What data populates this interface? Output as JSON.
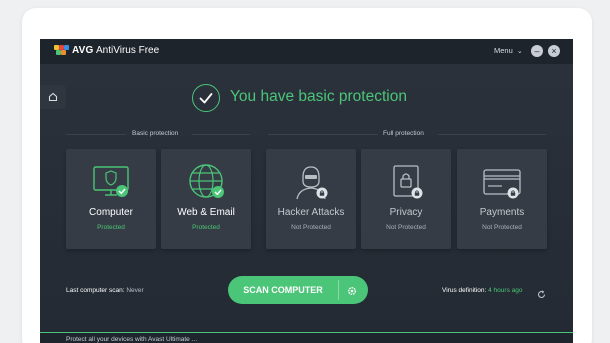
{
  "titlebar": {
    "brand": "AVG",
    "product": "AntiVirus Free",
    "menu_label": "Menu",
    "menu_chevron": "⌄",
    "minimize": "–",
    "close": "×"
  },
  "status": {
    "title": "You have basic protection"
  },
  "sections": {
    "basic_label": "Basic protection",
    "full_label": "Full protection"
  },
  "cards": [
    {
      "title": "Computer",
      "status": "Protected",
      "icon": "monitor-icon"
    },
    {
      "title": "Web & Email",
      "status": "Protected",
      "icon": "globe-icon"
    },
    {
      "title": "Hacker Attacks",
      "status": "Not Protected",
      "icon": "hacker-icon"
    },
    {
      "title": "Privacy",
      "status": "Not Protected",
      "icon": "lock-icon"
    },
    {
      "title": "Payments",
      "status": "Not Protected",
      "icon": "credit-card-icon"
    }
  ],
  "footer": {
    "last_scan_label": "Last computer scan:",
    "last_scan_value": "Never",
    "scan_button": "SCAN COMPUTER",
    "virus_def_label": "Virus definition:",
    "virus_def_value": "4 hours ago"
  },
  "bottom_bar": {
    "text": "Protect all your devices with Avast Ultimate ..."
  },
  "colors": {
    "accent": "#4bc577",
    "panel": "#353c46",
    "background": "#2b323c"
  }
}
